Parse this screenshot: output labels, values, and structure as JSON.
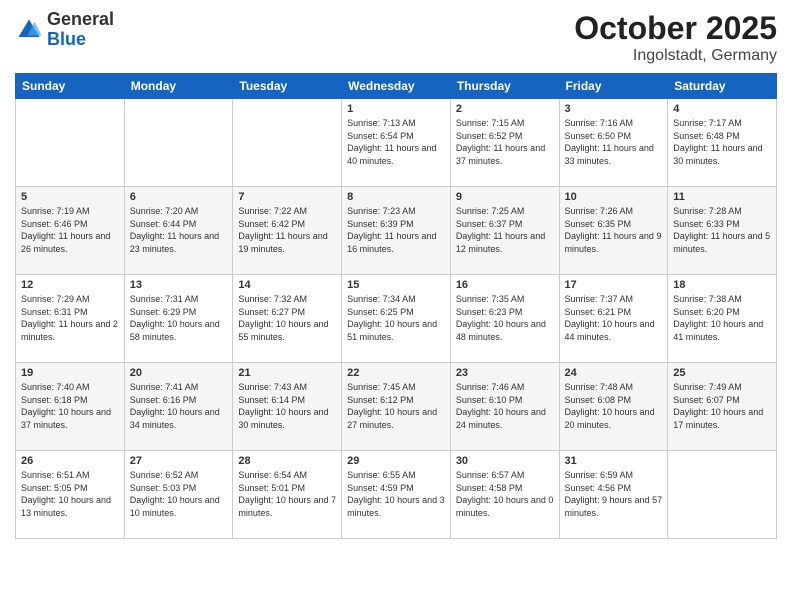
{
  "header": {
    "logo": {
      "general": "General",
      "blue": "Blue"
    },
    "title": "October 2025",
    "subtitle": "Ingolstadt, Germany"
  },
  "calendar": {
    "headers": [
      "Sunday",
      "Monday",
      "Tuesday",
      "Wednesday",
      "Thursday",
      "Friday",
      "Saturday"
    ],
    "weeks": [
      [
        {
          "day": "",
          "sunrise": "",
          "sunset": "",
          "daylight": ""
        },
        {
          "day": "",
          "sunrise": "",
          "sunset": "",
          "daylight": ""
        },
        {
          "day": "",
          "sunrise": "",
          "sunset": "",
          "daylight": ""
        },
        {
          "day": "1",
          "sunrise": "Sunrise: 7:13 AM",
          "sunset": "Sunset: 6:54 PM",
          "daylight": "Daylight: 11 hours and 40 minutes."
        },
        {
          "day": "2",
          "sunrise": "Sunrise: 7:15 AM",
          "sunset": "Sunset: 6:52 PM",
          "daylight": "Daylight: 11 hours and 37 minutes."
        },
        {
          "day": "3",
          "sunrise": "Sunrise: 7:16 AM",
          "sunset": "Sunset: 6:50 PM",
          "daylight": "Daylight: 11 hours and 33 minutes."
        },
        {
          "day": "4",
          "sunrise": "Sunrise: 7:17 AM",
          "sunset": "Sunset: 6:48 PM",
          "daylight": "Daylight: 11 hours and 30 minutes."
        }
      ],
      [
        {
          "day": "5",
          "sunrise": "Sunrise: 7:19 AM",
          "sunset": "Sunset: 6:46 PM",
          "daylight": "Daylight: 11 hours and 26 minutes."
        },
        {
          "day": "6",
          "sunrise": "Sunrise: 7:20 AM",
          "sunset": "Sunset: 6:44 PM",
          "daylight": "Daylight: 11 hours and 23 minutes."
        },
        {
          "day": "7",
          "sunrise": "Sunrise: 7:22 AM",
          "sunset": "Sunset: 6:42 PM",
          "daylight": "Daylight: 11 hours and 19 minutes."
        },
        {
          "day": "8",
          "sunrise": "Sunrise: 7:23 AM",
          "sunset": "Sunset: 6:39 PM",
          "daylight": "Daylight: 11 hours and 16 minutes."
        },
        {
          "day": "9",
          "sunrise": "Sunrise: 7:25 AM",
          "sunset": "Sunset: 6:37 PM",
          "daylight": "Daylight: 11 hours and 12 minutes."
        },
        {
          "day": "10",
          "sunrise": "Sunrise: 7:26 AM",
          "sunset": "Sunset: 6:35 PM",
          "daylight": "Daylight: 11 hours and 9 minutes."
        },
        {
          "day": "11",
          "sunrise": "Sunrise: 7:28 AM",
          "sunset": "Sunset: 6:33 PM",
          "daylight": "Daylight: 11 hours and 5 minutes."
        }
      ],
      [
        {
          "day": "12",
          "sunrise": "Sunrise: 7:29 AM",
          "sunset": "Sunset: 6:31 PM",
          "daylight": "Daylight: 11 hours and 2 minutes."
        },
        {
          "day": "13",
          "sunrise": "Sunrise: 7:31 AM",
          "sunset": "Sunset: 6:29 PM",
          "daylight": "Daylight: 10 hours and 58 minutes."
        },
        {
          "day": "14",
          "sunrise": "Sunrise: 7:32 AM",
          "sunset": "Sunset: 6:27 PM",
          "daylight": "Daylight: 10 hours and 55 minutes."
        },
        {
          "day": "15",
          "sunrise": "Sunrise: 7:34 AM",
          "sunset": "Sunset: 6:25 PM",
          "daylight": "Daylight: 10 hours and 51 minutes."
        },
        {
          "day": "16",
          "sunrise": "Sunrise: 7:35 AM",
          "sunset": "Sunset: 6:23 PM",
          "daylight": "Daylight: 10 hours and 48 minutes."
        },
        {
          "day": "17",
          "sunrise": "Sunrise: 7:37 AM",
          "sunset": "Sunset: 6:21 PM",
          "daylight": "Daylight: 10 hours and 44 minutes."
        },
        {
          "day": "18",
          "sunrise": "Sunrise: 7:38 AM",
          "sunset": "Sunset: 6:20 PM",
          "daylight": "Daylight: 10 hours and 41 minutes."
        }
      ],
      [
        {
          "day": "19",
          "sunrise": "Sunrise: 7:40 AM",
          "sunset": "Sunset: 6:18 PM",
          "daylight": "Daylight: 10 hours and 37 minutes."
        },
        {
          "day": "20",
          "sunrise": "Sunrise: 7:41 AM",
          "sunset": "Sunset: 6:16 PM",
          "daylight": "Daylight: 10 hours and 34 minutes."
        },
        {
          "day": "21",
          "sunrise": "Sunrise: 7:43 AM",
          "sunset": "Sunset: 6:14 PM",
          "daylight": "Daylight: 10 hours and 30 minutes."
        },
        {
          "day": "22",
          "sunrise": "Sunrise: 7:45 AM",
          "sunset": "Sunset: 6:12 PM",
          "daylight": "Daylight: 10 hours and 27 minutes."
        },
        {
          "day": "23",
          "sunrise": "Sunrise: 7:46 AM",
          "sunset": "Sunset: 6:10 PM",
          "daylight": "Daylight: 10 hours and 24 minutes."
        },
        {
          "day": "24",
          "sunrise": "Sunrise: 7:48 AM",
          "sunset": "Sunset: 6:08 PM",
          "daylight": "Daylight: 10 hours and 20 minutes."
        },
        {
          "day": "25",
          "sunrise": "Sunrise: 7:49 AM",
          "sunset": "Sunset: 6:07 PM",
          "daylight": "Daylight: 10 hours and 17 minutes."
        }
      ],
      [
        {
          "day": "26",
          "sunrise": "Sunrise: 6:51 AM",
          "sunset": "Sunset: 5:05 PM",
          "daylight": "Daylight: 10 hours and 13 minutes."
        },
        {
          "day": "27",
          "sunrise": "Sunrise: 6:52 AM",
          "sunset": "Sunset: 5:03 PM",
          "daylight": "Daylight: 10 hours and 10 minutes."
        },
        {
          "day": "28",
          "sunrise": "Sunrise: 6:54 AM",
          "sunset": "Sunset: 5:01 PM",
          "daylight": "Daylight: 10 hours and 7 minutes."
        },
        {
          "day": "29",
          "sunrise": "Sunrise: 6:55 AM",
          "sunset": "Sunset: 4:59 PM",
          "daylight": "Daylight: 10 hours and 3 minutes."
        },
        {
          "day": "30",
          "sunrise": "Sunrise: 6:57 AM",
          "sunset": "Sunset: 4:58 PM",
          "daylight": "Daylight: 10 hours and 0 minutes."
        },
        {
          "day": "31",
          "sunrise": "Sunrise: 6:59 AM",
          "sunset": "Sunset: 4:56 PM",
          "daylight": "Daylight: 9 hours and 57 minutes."
        },
        {
          "day": "",
          "sunrise": "",
          "sunset": "",
          "daylight": ""
        }
      ]
    ]
  }
}
